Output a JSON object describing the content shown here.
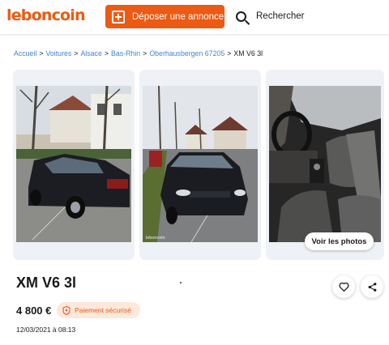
{
  "header": {
    "logo": "leboncoin",
    "deposit_label": "Déposer une annonce",
    "search_label": "Rechercher"
  },
  "breadcrumb": {
    "items": [
      "Accueil",
      "Voitures",
      "Alsace",
      "Bas-Rhin",
      "Oberhausbergen 67205"
    ],
    "current": "XM V6 3l",
    "separator": ">"
  },
  "gallery": {
    "photo_watermark": "leboncoin",
    "see_photos_label": "Voir les photos"
  },
  "listing": {
    "title": "XM V6 3l",
    "price": "4 800 €",
    "secure_payment_label": "Paiement sécurisé",
    "date": "12/03/2021 à 08:13"
  },
  "colors": {
    "brand": "#ec5a13",
    "link": "#4183d7",
    "badge_bg": "#fde8dc"
  },
  "icons": [
    "plus-square-icon",
    "search-icon",
    "heart-icon",
    "share-icon",
    "shield-icon"
  ]
}
